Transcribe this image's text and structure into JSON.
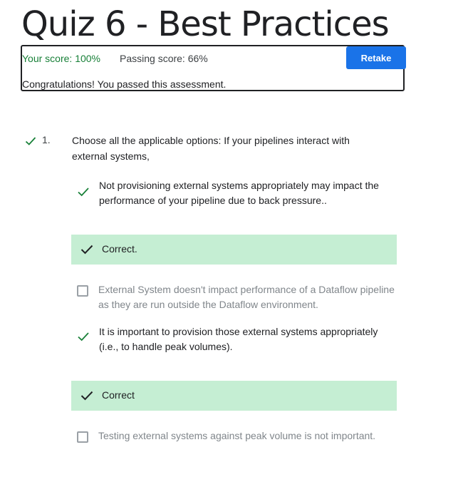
{
  "page": {
    "title": "Quiz 6 - Best Practices"
  },
  "score": {
    "your_score": "Your score: 100%",
    "passing_score": "Passing score: 66%",
    "message": "Congratulations! You passed this assessment.",
    "retake_label": "Retake"
  },
  "question": {
    "number": "1.",
    "text": "Choose all the applicable options: If your pipelines interact with external systems,",
    "options": [
      {
        "text": "Not provisioning external systems appropriately may impact the performance of your pipeline due to back pressure..",
        "selected": true,
        "feedback": "Correct."
      },
      {
        "text": "External System doesn't impact performance of a Dataflow pipeline as they are run outside the Dataflow environment.",
        "selected": false
      },
      {
        "text": "It is important to provision those external systems appropriately (i.e., to handle peak volumes).",
        "selected": true,
        "feedback": "Correct"
      },
      {
        "text": "Testing external systems against peak volume is not important.",
        "selected": false
      }
    ]
  },
  "icons": {
    "check": "check-icon",
    "checkbox": "checkbox-icon"
  },
  "colors": {
    "correct_green": "#188038",
    "feedback_bg": "#c5eed3",
    "button_blue": "#1a73e8"
  }
}
